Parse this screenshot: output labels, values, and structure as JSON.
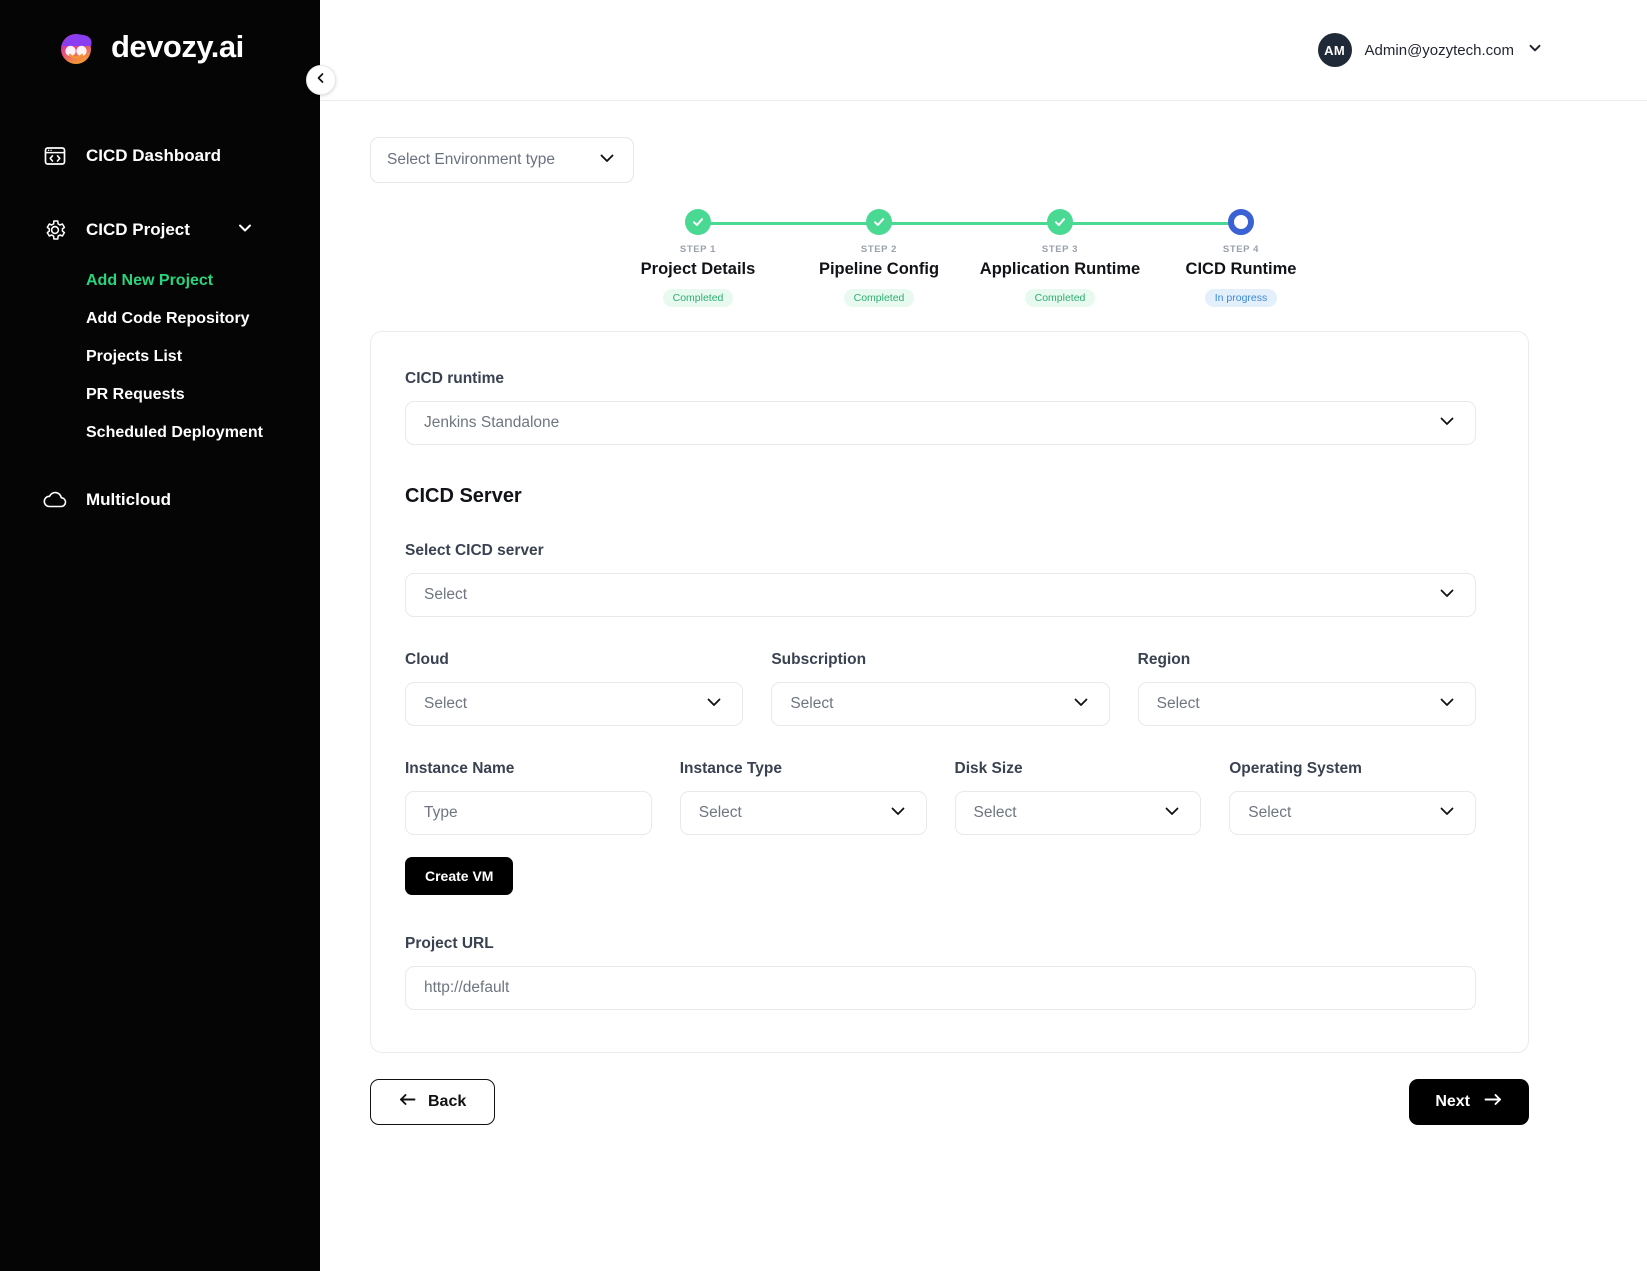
{
  "brand": {
    "name": "devozy.ai",
    "logo_icon": "devozy-logo-icon"
  },
  "sidebar": {
    "collapse_icon": "chevron-left-icon",
    "items": [
      {
        "label": "CICD Dashboard",
        "icon": "code-window-icon",
        "expandable": false
      },
      {
        "label": "CICD Project",
        "icon": "gear-icon",
        "expandable": true,
        "chevron": "chevron-down-icon"
      },
      {
        "label": "Multicloud",
        "icon": "cloud-icon",
        "expandable": false
      }
    ],
    "sub_items": [
      {
        "label": "Add New Project",
        "active": true
      },
      {
        "label": "Add Code Repository",
        "active": false
      },
      {
        "label": "Projects List",
        "active": false
      },
      {
        "label": "PR Requests",
        "active": false
      },
      {
        "label": "Scheduled Deployment",
        "active": false
      }
    ]
  },
  "topbar": {
    "avatar_initials": "AM",
    "user_email": "Admin@yozytech.com",
    "chevron_icon": "chevron-down-icon"
  },
  "environment_select": {
    "placeholder": "Select Environment type",
    "chevron_icon": "chevron-down-icon"
  },
  "stepper": {
    "steps": [
      {
        "num": "STEP 1",
        "label": "Project Details",
        "status": "Completed",
        "state": "done"
      },
      {
        "num": "STEP 2",
        "label": "Pipeline Config",
        "status": "Completed",
        "state": "done"
      },
      {
        "num": "STEP 3",
        "label": "Application Runtime",
        "status": "Completed",
        "state": "done"
      },
      {
        "num": "STEP 4",
        "label": "CICD Runtime",
        "status": "In progress",
        "state": "current"
      }
    ]
  },
  "form": {
    "cicd_runtime": {
      "label": "CICD runtime",
      "value": "Jenkins Standalone",
      "chevron_icon": "chevron-down-icon"
    },
    "section_title": "CICD Server",
    "cicd_server": {
      "label": "Select  CICD server",
      "placeholder": "Select",
      "chevron_icon": "chevron-down-icon"
    },
    "cloud": {
      "label": "Cloud",
      "placeholder": "Select",
      "chevron_icon": "chevron-down-icon"
    },
    "subscription": {
      "label": "Subscription",
      "placeholder": "Select",
      "chevron_icon": "chevron-down-icon"
    },
    "region": {
      "label": "Region",
      "placeholder": "Select",
      "chevron_icon": "chevron-down-icon"
    },
    "instance_name": {
      "label": "Instance Name",
      "placeholder": "Type"
    },
    "instance_type": {
      "label": "Instance Type",
      "placeholder": "Select",
      "chevron_icon": "chevron-down-icon"
    },
    "disk_size": {
      "label": "Disk Size",
      "placeholder": "Select",
      "chevron_icon": "chevron-down-icon"
    },
    "operating_system": {
      "label": "Operating System",
      "placeholder": "Select",
      "chevron_icon": "chevron-down-icon"
    },
    "create_vm_label": "Create VM",
    "project_url": {
      "label": "Project URL",
      "placeholder": "http://default"
    }
  },
  "footer": {
    "back_label": "Back",
    "back_icon": "arrow-left-icon",
    "next_label": "Next",
    "next_icon": "arrow-right-icon"
  },
  "colors": {
    "accent_green": "#2ad47f",
    "step_done": "#4ad992",
    "step_current": "#3b62d4",
    "sidebar_bg": "#050505",
    "primary_dark": "#000000"
  }
}
